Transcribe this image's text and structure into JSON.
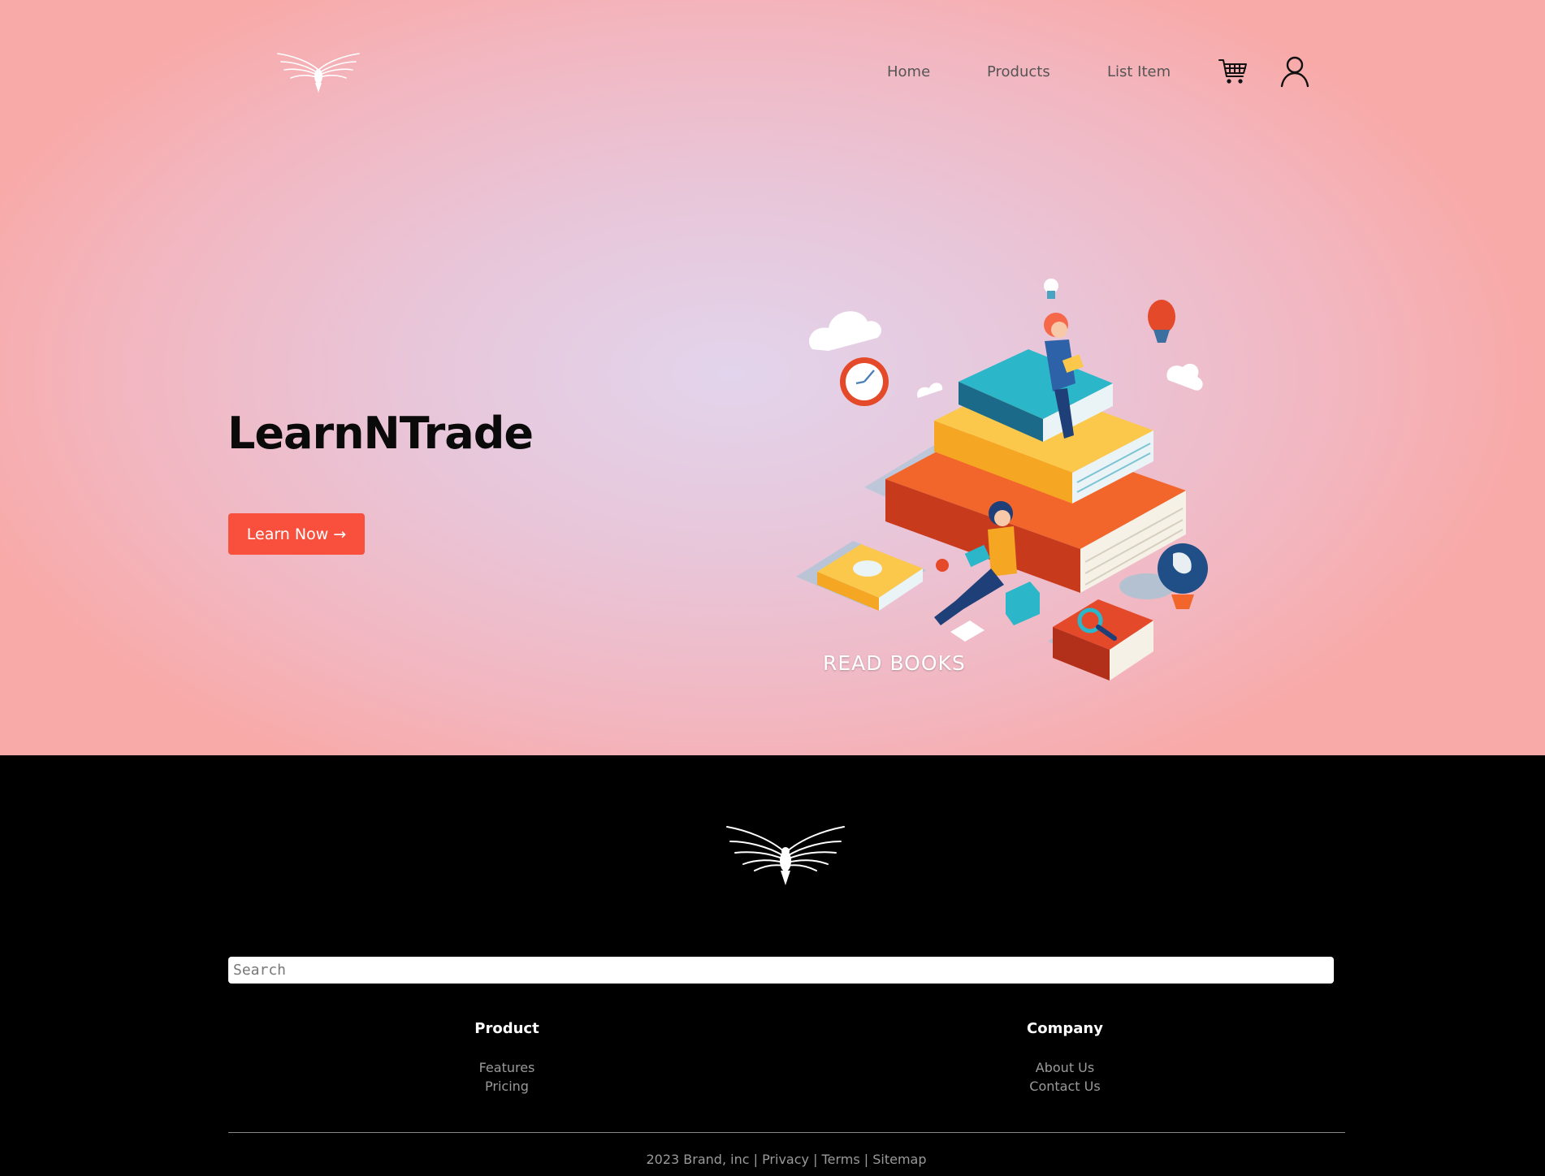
{
  "nav": {
    "logo_icon": "eagle-icon",
    "links": [
      {
        "label": "Home"
      },
      {
        "label": "Products"
      },
      {
        "label": "List Item"
      }
    ],
    "cart_icon": "cart-icon",
    "user_icon": "user-icon"
  },
  "hero": {
    "title": "LearnNTrade",
    "cta_label": "Learn Now →",
    "illustration_caption": "READ BOOKS"
  },
  "footer": {
    "logo_icon": "eagle-icon",
    "search_placeholder": "Search",
    "columns": [
      {
        "heading": "Product",
        "links": [
          "Features",
          "Pricing"
        ]
      },
      {
        "heading": "Company",
        "links": [
          "About Us",
          "Contact Us"
        ]
      }
    ],
    "copyright": "2023 Brand, inc | Privacy | Terms | Sitemap"
  },
  "colors": {
    "accent": "#f9503e",
    "hero_gradient_center": "#e2d4ec",
    "hero_gradient_edge": "#f8aaa9",
    "footer_bg": "#000000"
  }
}
